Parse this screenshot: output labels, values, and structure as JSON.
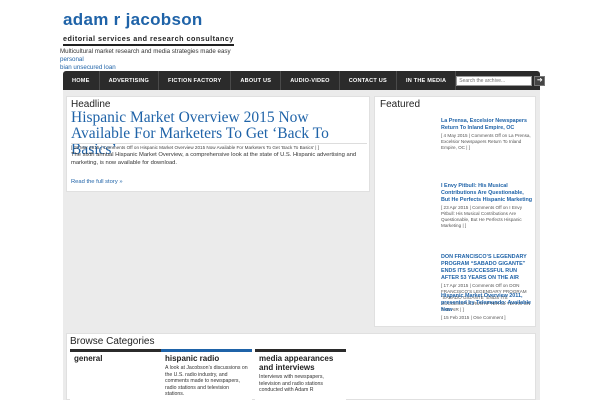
{
  "header": {
    "site_title": "adam r jacobson",
    "tagline": "editorial services and research consultancy",
    "description_prefix": "Multicultural market research and media strategies made easy",
    "description_link": "personal",
    "description_link2": "bian unsecured loan"
  },
  "nav": {
    "items": [
      "HOME",
      "ADVERTISING",
      "FICTION FACTORY",
      "ABOUT US",
      "AUDIO-VIDEO",
      "CONTACT US",
      "IN THE MEDIA"
    ],
    "search_placeholder": "Search the archive...",
    "search_icon": "search-arrow-icon"
  },
  "main": {
    "label": "Headline",
    "headline": "Hispanic Market Overview 2015 Now Available For Marketers To Get ‘Back To Basics’",
    "meta": "[ 26 Mar 2015 | Comments Off on Hispanic Market Overview 2015 Now Available For Marketers To Get ‘Back To Basics’ | ]",
    "excerpt": "The sixth annual Hispanic Market Overview, a comprehensive look at the state of U.S. Hispanic advertising and marketing, is now available for download.",
    "read_more": "Read the full story »"
  },
  "featured": {
    "label": "Featured",
    "items": [
      {
        "title": "La Prensa, Excelsior Newspapers Return To Inland Empire, OC",
        "meta": "[ 4 May 2015 | Comments Off on La Prensa, Excelsior Newspapers Return To Inland Empire, OC | ]"
      },
      {
        "title": "I Envy Pitbull: His Musical Contributions Are Questionable, But He Perfects Hispanic Marketing",
        "meta": "[ 23 Apr 2015 | Comments Off on I Envy Pitbull: His Musical Contributions Are Questionable, But He Perfects Hispanic Marketing | ]"
      },
      {
        "title": "DON FRANCISCO’S LEGENDARY PROGRAM “SABADO GIGANTE” ENDS ITS SUCCESSFUL RUN AFTER 53 YEARS ON THE AIR",
        "meta": "[ 17 Apr 2015 | Comments Off on DON FRANCISCO’S LEGENDARY PROGRAM “SABADO GIGANTE” ENDS ITS SUCCESSFUL RUN AFTER 53 YEARS ON THE AIR | ]"
      },
      {
        "title": "Hispanic Market Overview 2011, presented by Telemundo: Available Now",
        "meta": "[ 15 Feb 2015 | One Comment ]"
      }
    ]
  },
  "browse": {
    "label": "Browse Categories",
    "categories": [
      {
        "title": "general",
        "desc": ""
      },
      {
        "title": "hispanic radio",
        "desc": "A look at Jacobson’s discussions on the U.S. radio industry, and comments made to newspapers, radio stations and television stations."
      },
      {
        "title": "media appearances and interviews",
        "desc": "Interviews with newspapers, television and radio stations conducted with Adam R"
      }
    ]
  }
}
